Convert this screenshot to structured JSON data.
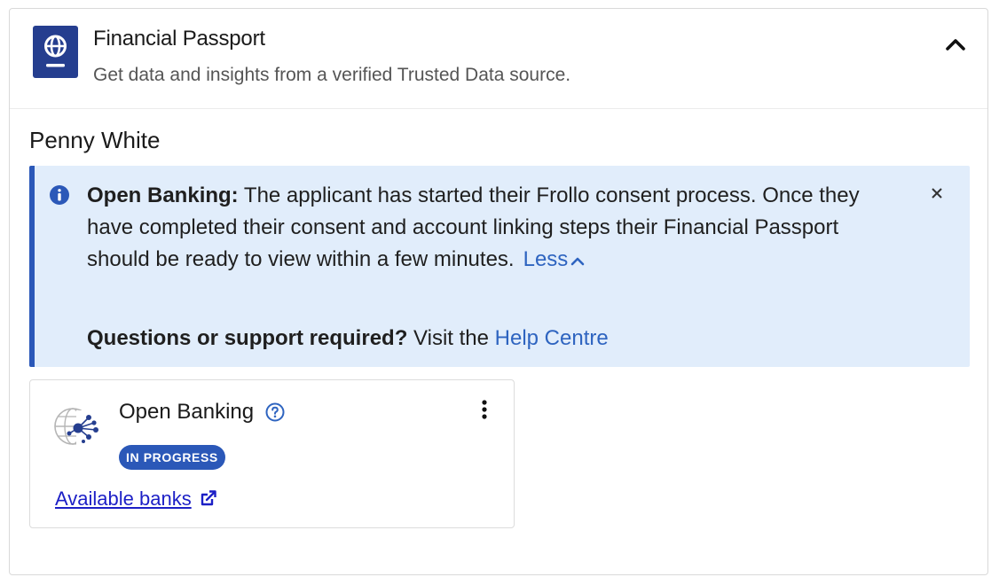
{
  "header": {
    "title": "Financial Passport",
    "subtitle": "Get data and insights from a verified Trusted Data source.",
    "icon": "globe-passport-icon",
    "collapse_icon": "chevron-up-icon"
  },
  "applicant": {
    "name": "Penny White"
  },
  "alert": {
    "heading": "Open Banking:",
    "body": "The applicant has started their Frollo consent process. Once they have completed their consent and account linking steps their Financial Passport should be ready to view within a few minutes.",
    "toggle_label": "Less",
    "support_heading": "Questions or support required?",
    "support_text": "Visit the",
    "support_link": "Help Centre",
    "icon": "info-icon",
    "close_icon": "close-icon"
  },
  "card": {
    "title": "Open Banking",
    "status": "IN PROGRESS",
    "link_label": "Available banks",
    "icons": [
      "open-banking-network-icon",
      "help-circle-icon",
      "kebab-menu-icon",
      "external-link-icon"
    ]
  },
  "colors": {
    "brand": "#253e8f",
    "accent": "#2b58b8",
    "alert_bg": "#e1edfb",
    "link": "#2e64c0",
    "visited_link": "#1c1fc6"
  }
}
